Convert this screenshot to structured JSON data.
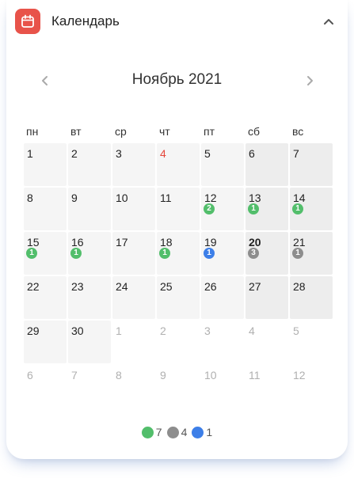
{
  "header": {
    "title": "Календарь"
  },
  "nav": {
    "month_title": "Ноябрь 2021"
  },
  "weekdays": [
    "пн",
    "вт",
    "ср",
    "чт",
    "пт",
    "сб",
    "вс"
  ],
  "days": [
    {
      "n": "1",
      "m": "cur"
    },
    {
      "n": "2",
      "m": "cur"
    },
    {
      "n": "3",
      "m": "cur"
    },
    {
      "n": "4",
      "m": "cur",
      "today": true
    },
    {
      "n": "5",
      "m": "cur"
    },
    {
      "n": "6",
      "m": "cur",
      "w": true
    },
    {
      "n": "7",
      "m": "cur",
      "w": true
    },
    {
      "n": "8",
      "m": "cur"
    },
    {
      "n": "9",
      "m": "cur"
    },
    {
      "n": "10",
      "m": "cur"
    },
    {
      "n": "11",
      "m": "cur"
    },
    {
      "n": "12",
      "m": "cur",
      "badge": "2",
      "bc": "green"
    },
    {
      "n": "13",
      "m": "cur",
      "w": true,
      "badge": "1",
      "bc": "green"
    },
    {
      "n": "14",
      "m": "cur",
      "w": true,
      "badge": "1",
      "bc": "green"
    },
    {
      "n": "15",
      "m": "cur",
      "badge": "1",
      "bc": "green"
    },
    {
      "n": "16",
      "m": "cur",
      "badge": "1",
      "bc": "green"
    },
    {
      "n": "17",
      "m": "cur"
    },
    {
      "n": "18",
      "m": "cur",
      "badge": "1",
      "bc": "green"
    },
    {
      "n": "19",
      "m": "cur",
      "badge": "1",
      "bc": "blue"
    },
    {
      "n": "20",
      "m": "cur",
      "w": true,
      "bold": true,
      "badge": "3",
      "bc": "gray"
    },
    {
      "n": "21",
      "m": "cur",
      "w": true,
      "badge": "1",
      "bc": "gray"
    },
    {
      "n": "22",
      "m": "cur"
    },
    {
      "n": "23",
      "m": "cur"
    },
    {
      "n": "24",
      "m": "cur"
    },
    {
      "n": "25",
      "m": "cur"
    },
    {
      "n": "26",
      "m": "cur"
    },
    {
      "n": "27",
      "m": "cur",
      "w": true
    },
    {
      "n": "28",
      "m": "cur",
      "w": true
    },
    {
      "n": "29",
      "m": "cur"
    },
    {
      "n": "30",
      "m": "cur"
    },
    {
      "n": "1",
      "m": "other"
    },
    {
      "n": "2",
      "m": "other"
    },
    {
      "n": "3",
      "m": "other"
    },
    {
      "n": "4",
      "m": "other"
    },
    {
      "n": "5",
      "m": "other"
    },
    {
      "n": "6",
      "m": "other"
    },
    {
      "n": "7",
      "m": "other"
    },
    {
      "n": "8",
      "m": "other"
    },
    {
      "n": "9",
      "m": "other"
    },
    {
      "n": "10",
      "m": "other"
    },
    {
      "n": "11",
      "m": "other"
    },
    {
      "n": "12",
      "m": "other"
    }
  ],
  "legend": [
    {
      "count": "7",
      "color": "green"
    },
    {
      "count": "4",
      "color": "gray"
    },
    {
      "count": "1",
      "color": "blue"
    }
  ],
  "colors": {
    "green": "#52be6b",
    "gray": "#8d8d8d",
    "blue": "#3d7fe8",
    "accent": "#e8534a",
    "today": "#e5473b"
  },
  "icons": {
    "app": "calendar-icon",
    "collapse": "chevron-up-icon",
    "prev": "chevron-left-icon",
    "next": "chevron-right-icon"
  }
}
